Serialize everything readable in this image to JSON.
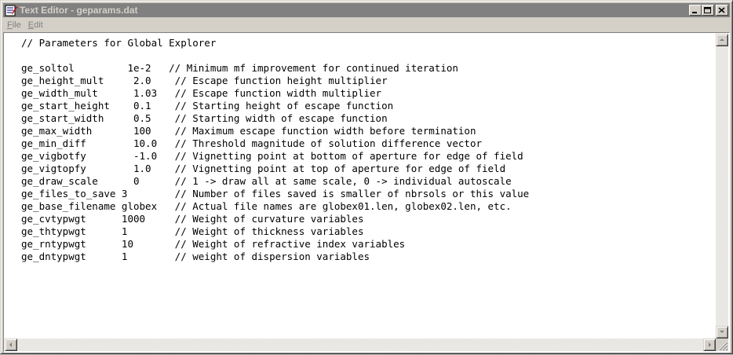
{
  "window": {
    "title": "Text Editor - geparams.dat"
  },
  "menu": {
    "file": {
      "accel": "F",
      "rest": "ile"
    },
    "edit": {
      "accel": "E",
      "rest": "dit"
    }
  },
  "editor": {
    "content": "// Parameters for Global Explorer\n\nge_soltol         1e-2   // Minimum mf improvement for continued iteration\nge_height_mult     2.0    // Escape function height multiplier\nge_width_mult      1.03   // Escape function width multiplier\nge_start_height    0.1    // Starting height of escape function\nge_start_width     0.5    // Starting width of escape function\nge_max_width       100    // Maximum escape function width before termination\nge_min_diff        10.0   // Threshold magnitude of solution difference vector\nge_vigbotfy        -1.0   // Vignetting point at bottom of aperture for edge of field\nge_vigtopfy        1.0    // Vignetting point at top of aperture for edge of field\nge_draw_scale      0      // 1 -> draw all at same scale, 0 -> individual autoscale\nge_files_to_save 3        // Number of files saved is smaller of nbrsols or this value\nge_base_filename globex   // Actual file names are globex01.len, globex02.len, etc.\nge_cvtypwgt      1000     // Weight of curvature variables\nge_thtypwgt      1        // Weight of thickness variables\nge_rntypwgt      10       // Weight of refractive index variables\nge_dntypwgt      1        // weight of dispersion variables"
  },
  "icons": {
    "app": "text-editor-icon",
    "minimize": "minimize-icon",
    "maximize": "maximize-icon",
    "close": "close-icon",
    "scroll_up": "arrow-up-icon",
    "scroll_down": "arrow-down-icon",
    "scroll_left": "arrow-left-icon",
    "scroll_right": "arrow-right-icon"
  },
  "colors": {
    "titlebar_inactive": "#808080",
    "window_face": "#d4d0c8"
  }
}
